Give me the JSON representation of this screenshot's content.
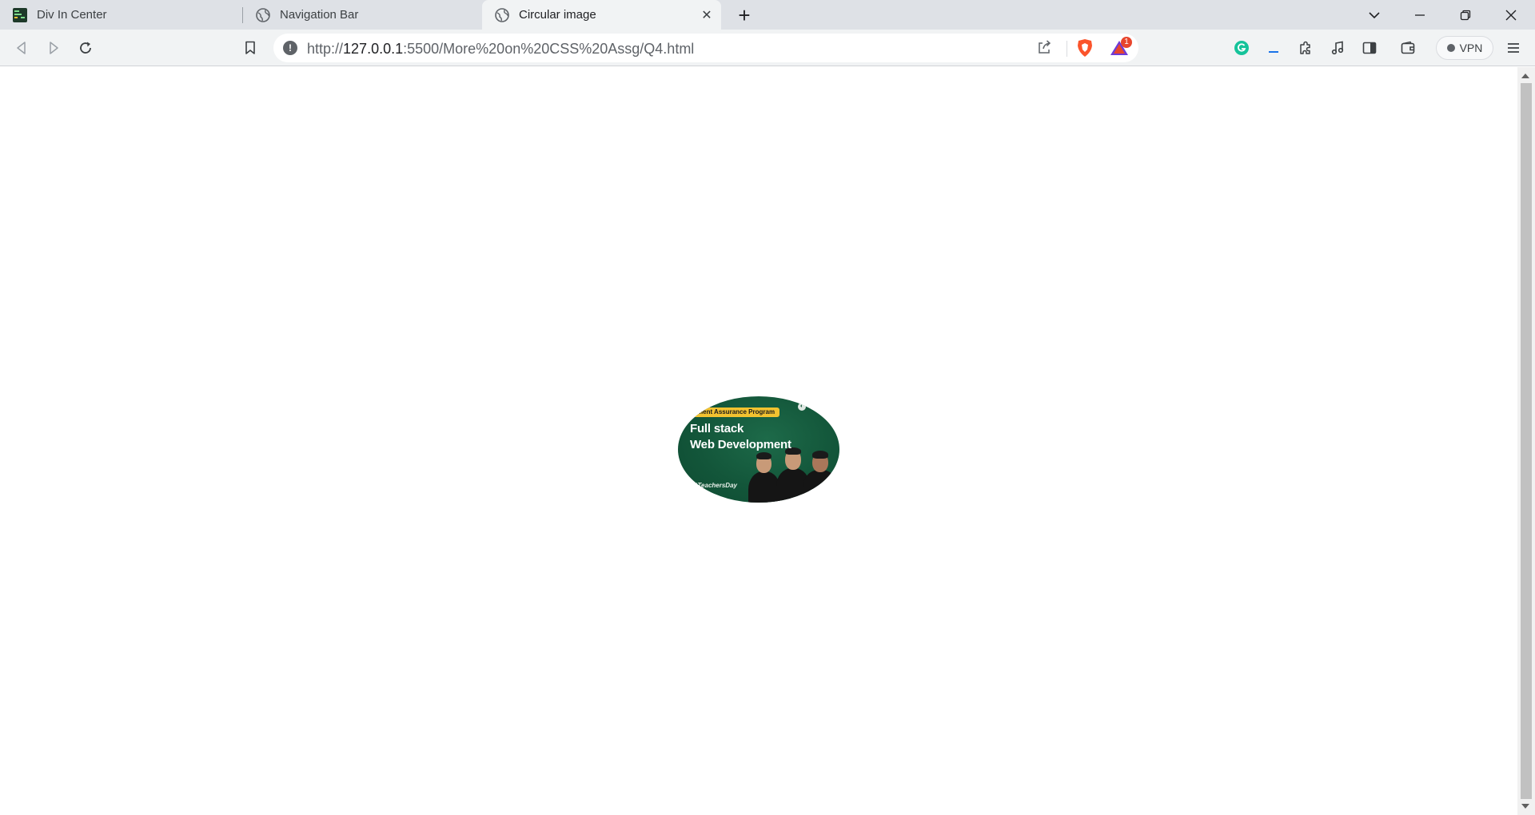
{
  "browser": {
    "tabs": [
      {
        "title": "Div In Center",
        "active": false,
        "favicon": "green-terminal-icon"
      },
      {
        "title": "Navigation Bar",
        "active": false,
        "favicon": "globe-icon"
      },
      {
        "title": "Circular image",
        "active": true,
        "favicon": "globe-icon"
      }
    ],
    "new_tab_label": "+",
    "close_tab_glyph": "✕",
    "address": {
      "scheme": "http://",
      "host": "127.0.0.1",
      "rest": ":5500/More%20on%20CSS%20Assg/Q4.html"
    },
    "info_glyph": "!",
    "vpn_label": "VPN",
    "rewards_badge": "1",
    "colors": {
      "brave_orange": "#fb542b",
      "grammarly_green": "#15c39a",
      "tab_strip": "#dee1e6",
      "toolbar": "#f1f3f4"
    }
  },
  "page": {
    "image": {
      "program_label": "ment Assurance Program",
      "title_line1": "Full stack",
      "title_line2": "Web Development",
      "hashtag": "#TeachersDay",
      "background_color": "#13563a"
    }
  }
}
